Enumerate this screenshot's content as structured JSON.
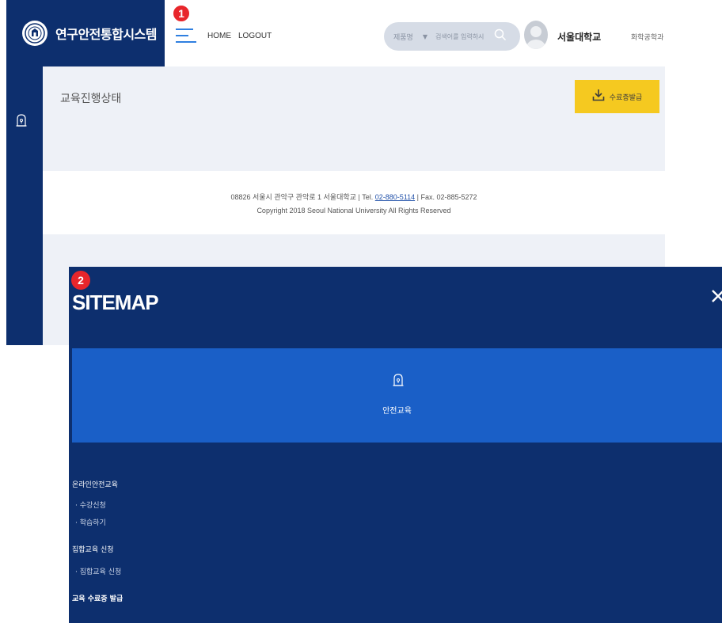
{
  "header": {
    "app_title": "연구안전통합시스템",
    "nav": {
      "home": "HOME",
      "logout": "LOGOUT"
    },
    "search": {
      "category": "제품명",
      "caret": "▼",
      "placeholder": "검색어를 입력하시"
    },
    "user": {
      "university": "서울대학교",
      "department": "화학공학과"
    }
  },
  "badges": {
    "first": "1",
    "second": "2"
  },
  "content": {
    "page_title": "교육진행상태",
    "cert_button_label": "수료증발급"
  },
  "footer": {
    "address_prefix": "08826 서울시 관악구 관악로 1 서울대학교 | Tel. ",
    "phone": "02-880-5114",
    "fax": " | Fax. 02-885-5272",
    "copyright": "Copyright 2018 Seoul National University All Rights Reserved"
  },
  "sitemap": {
    "title": "SITEMAP",
    "close_symbol": "✕",
    "category_label": "안전교육",
    "menu": [
      {
        "label": "온라인안전교육"
      },
      {
        "label": "· 수강신청"
      },
      {
        "label": "· 학습하기"
      },
      {
        "label": "집합교육 신청"
      },
      {
        "label": "· 집합교육 신청"
      },
      {
        "label": "교육 수료증 발급"
      }
    ]
  },
  "colors": {
    "navy": "#0d2f6e",
    "band_blue": "#1a5fc7",
    "accent_yellow": "#f5c920",
    "hamburger_blue": "#2f7fe0",
    "badge_red": "#e8262b"
  },
  "icons": {
    "logo": "university-emblem-icon",
    "menu": "hamburger-icon",
    "search": "search-icon",
    "avatar": "user-avatar-icon",
    "download": "download-icon",
    "safety": "safety-lock-icon",
    "close": "close-icon"
  }
}
